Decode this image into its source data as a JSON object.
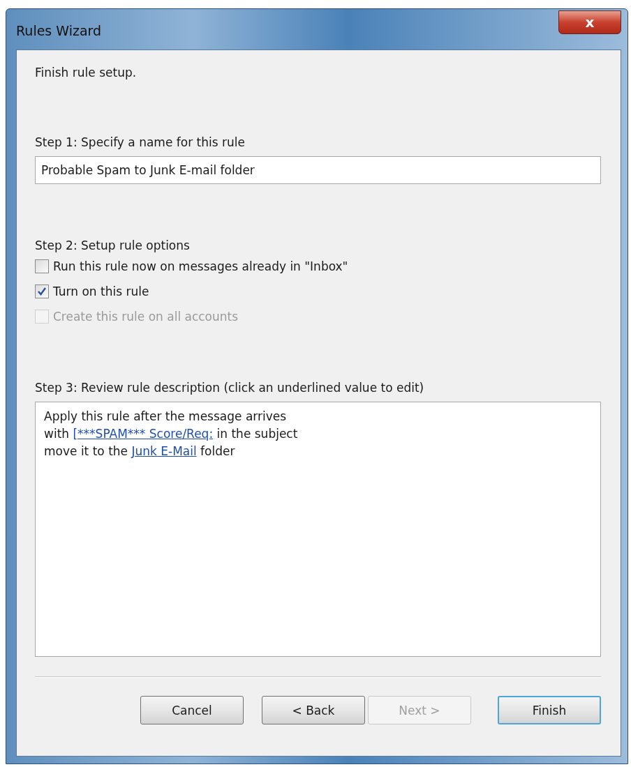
{
  "window": {
    "title": "Rules Wizard",
    "close_label": "x"
  },
  "heading": "Finish rule setup.",
  "step1": {
    "label": "Step 1: Specify a name for this rule",
    "value": "Probable Spam to Junk E-mail folder"
  },
  "step2": {
    "label": "Step 2: Setup rule options",
    "options": [
      {
        "label": "Run this rule now on messages already in \"Inbox\"",
        "checked": false,
        "disabled": false
      },
      {
        "label": "Turn on this rule",
        "checked": true,
        "disabled": false
      },
      {
        "label": "Create this rule on all accounts",
        "checked": false,
        "disabled": true
      }
    ]
  },
  "step3": {
    "label": "Step 3: Review rule description (click an underlined value to edit)",
    "lines": [
      [
        {
          "kind": "text",
          "text": "Apply this rule after the message arrives"
        }
      ],
      [
        {
          "kind": "text",
          "text": "with "
        },
        {
          "kind": "link",
          "text": "[***SPAM*** Score/Req:"
        },
        {
          "kind": "text",
          "text": " in the subject"
        }
      ],
      [
        {
          "kind": "text",
          "text": "move it to the "
        },
        {
          "kind": "link",
          "text": "Junk E-Mail"
        },
        {
          "kind": "text",
          "text": " folder"
        }
      ]
    ]
  },
  "buttons": [
    {
      "label": "Cancel",
      "disabled": false,
      "default": false
    },
    {
      "label": "< Back",
      "disabled": false,
      "default": false
    },
    {
      "label": "Next >",
      "disabled": true,
      "default": false
    },
    {
      "label": "Finish",
      "disabled": false,
      "default": true
    }
  ]
}
